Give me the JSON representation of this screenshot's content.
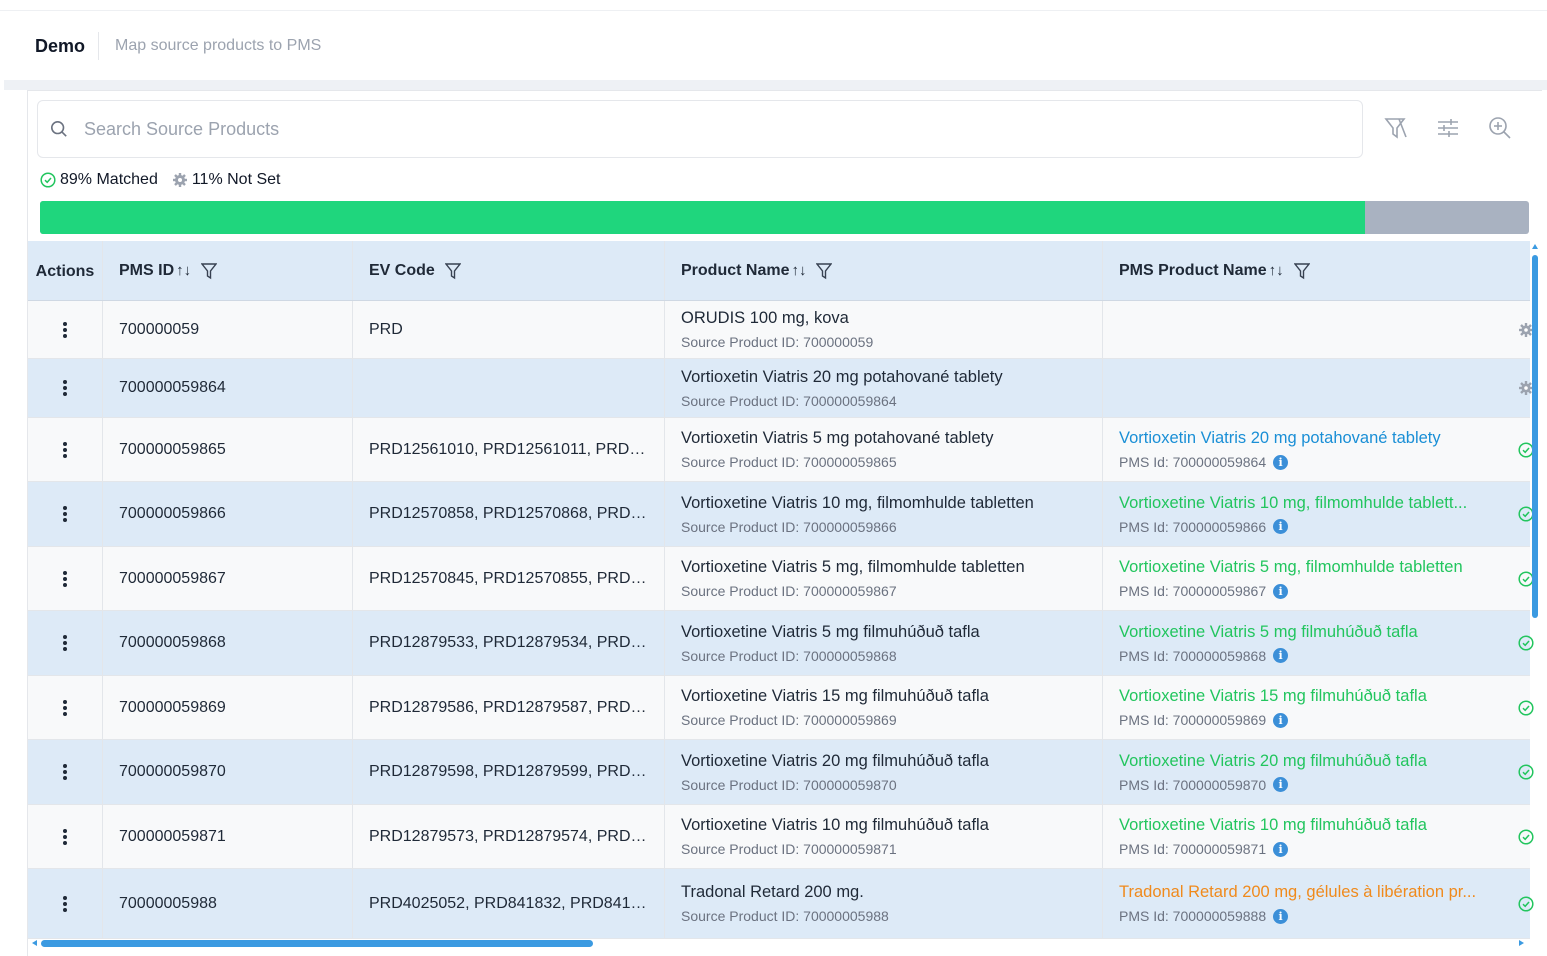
{
  "header": {
    "title": "Demo",
    "subtitle": "Map source products to PMS"
  },
  "search": {
    "placeholder": "Search Source Products"
  },
  "toolbar": {
    "icons": [
      "clear-filter-icon",
      "sliders-icon",
      "zoom-in-icon"
    ]
  },
  "stats": {
    "matched_label": "89% Matched",
    "notset_label": "11% Not Set",
    "matched_fraction": 0.89
  },
  "colors": {
    "matched": "#1fd67d",
    "not_set": "#a9b2c1",
    "link_blue": "#1a8fd6",
    "link_green": "#22c55e",
    "link_orange": "#f08a1c",
    "header_bg": "#ddeaf7"
  },
  "table": {
    "columns": [
      {
        "label": "Actions",
        "sortable": false,
        "filterable": false
      },
      {
        "label": "PMS ID",
        "sortable": true,
        "filterable": true
      },
      {
        "label": "EV Code",
        "sortable": false,
        "filterable": true
      },
      {
        "label": "Product Name",
        "sortable": true,
        "filterable": true
      },
      {
        "label": "PMS Product Name",
        "sortable": true,
        "filterable": true
      }
    ],
    "rows": [
      {
        "pms_id": "700000059",
        "ev_code": "PRD",
        "product": "ORUDIS 100 mg, kova",
        "source_id": "Source Product ID: 700000059",
        "pms_name": "",
        "pms_sub": "",
        "status": "not-set"
      },
      {
        "pms_id": "700000059864",
        "ev_code": "",
        "product": "Vortioxetin Viatris 20 mg potahované tablety",
        "source_id": "Source Product ID: 700000059864",
        "pms_name": "",
        "pms_sub": "",
        "status": "not-set"
      },
      {
        "pms_id": "700000059865",
        "ev_code": "PRD12561010, PRD12561011, PRD12561...",
        "product": "Vortioxetin Viatris 5 mg potahované tablety",
        "source_id": "Source Product ID: 700000059865",
        "pms_name": "Vortioxetin Viatris 20 mg potahované tablety",
        "pms_sub": "PMS Id: 700000059864",
        "status": "blue"
      },
      {
        "pms_id": "700000059866",
        "ev_code": "PRD12570858, PRD12570868, PRD12...",
        "product": "Vortioxetine Viatris 10 mg, filmomhulde tabletten",
        "source_id": "Source Product ID: 700000059866",
        "pms_name": "Vortioxetine Viatris 10 mg, filmomhulde tablett...",
        "pms_sub": "PMS Id: 700000059866",
        "status": "green"
      },
      {
        "pms_id": "700000059867",
        "ev_code": "PRD12570845, PRD12570855, PRD12...",
        "product": "Vortioxetine Viatris 5 mg, filmomhulde tabletten",
        "source_id": "Source Product ID: 700000059867",
        "pms_name": "Vortioxetine Viatris 5 mg, filmomhulde tabletten",
        "pms_sub": "PMS Id: 700000059867",
        "status": "green"
      },
      {
        "pms_id": "700000059868",
        "ev_code": "PRD12879533, PRD12879534, PRD12...",
        "product": "Vortioxetine Viatris 5 mg filmuhúðuð tafla",
        "source_id": "Source Product ID: 700000059868",
        "pms_name": "Vortioxetine Viatris 5 mg filmuhúðuð tafla",
        "pms_sub": "PMS Id: 700000059868",
        "status": "green"
      },
      {
        "pms_id": "700000059869",
        "ev_code": "PRD12879586, PRD12879587, PRD12...",
        "product": "Vortioxetine Viatris 15 mg filmuhúðuð tafla",
        "source_id": "Source Product ID: 700000059869",
        "pms_name": "Vortioxetine Viatris 15 mg filmuhúðuð tafla",
        "pms_sub": "PMS Id: 700000059869",
        "status": "green"
      },
      {
        "pms_id": "700000059870",
        "ev_code": "PRD12879598, PRD12879599, PRD12...",
        "product": "Vortioxetine Viatris 20 mg filmuhúðuð tafla",
        "source_id": "Source Product ID: 700000059870",
        "pms_name": "Vortioxetine Viatris 20 mg filmuhúðuð tafla",
        "pms_sub": "PMS Id: 700000059870",
        "status": "green"
      },
      {
        "pms_id": "700000059871",
        "ev_code": "PRD12879573, PRD12879574, PRD128...",
        "product": "Vortioxetine Viatris 10 mg filmuhúðuð tafla",
        "source_id": "Source Product ID: 700000059871",
        "pms_name": "Vortioxetine Viatris 10 mg filmuhúðuð tafla",
        "pms_sub": "PMS Id: 700000059871",
        "status": "green"
      },
      {
        "pms_id": "70000005988",
        "ev_code": "PRD4025052, PRD841832, PRD841841",
        "product": "Tradonal Retard 200 mg.",
        "source_id": "Source Product ID: 70000005988",
        "pms_name": "Tradonal Retard 200 mg, gélules à libération pr...",
        "pms_sub": "PMS Id: 700000059888",
        "status": "orange"
      }
    ]
  }
}
